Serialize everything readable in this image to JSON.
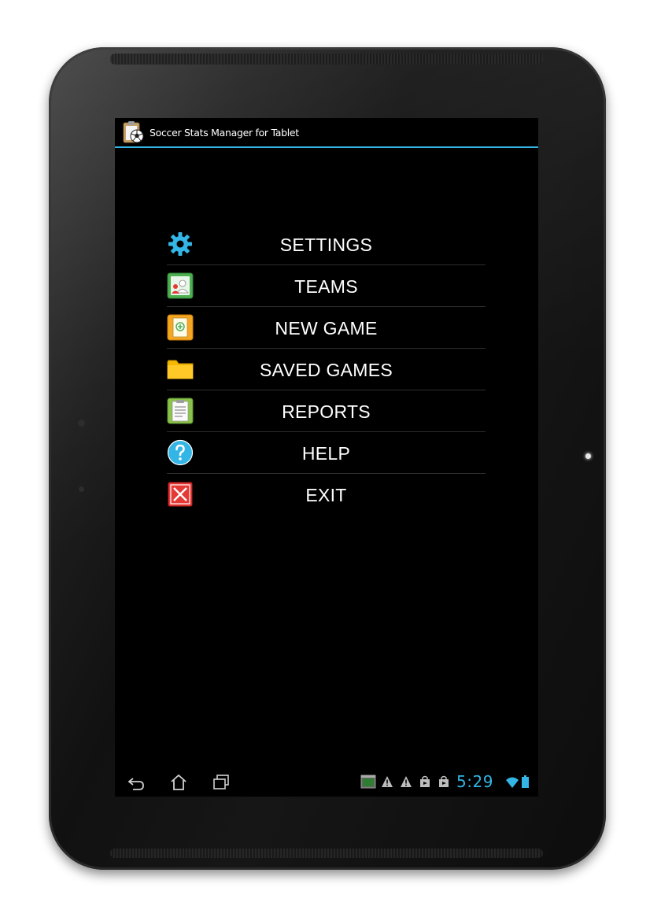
{
  "app": {
    "title": "Soccer Stats Manager for Tablet",
    "app_icon": "soccer-clipboard-icon"
  },
  "menu": {
    "items": [
      {
        "label": "SETTINGS",
        "icon": "gear-icon",
        "icon_color": "#33b5e5"
      },
      {
        "label": "TEAMS",
        "icon": "teams-icon",
        "icon_color": "#4caf50"
      },
      {
        "label": "NEW GAME",
        "icon": "new-game-icon",
        "icon_color": "#f5a623"
      },
      {
        "label": "SAVED GAMES",
        "icon": "folder-icon",
        "icon_color": "#f5b800"
      },
      {
        "label": "REPORTS",
        "icon": "reports-icon",
        "icon_color": "#8bc34a"
      },
      {
        "label": "HELP",
        "icon": "help-icon",
        "icon_color": "#33b5e5"
      },
      {
        "label": "EXIT",
        "icon": "exit-icon",
        "icon_color": "#e53935"
      }
    ]
  },
  "status_bar": {
    "time": "5:29",
    "accent_color": "#33b5e5",
    "nav_icons": [
      "back-icon",
      "home-icon",
      "recent-apps-icon"
    ],
    "notification_icons": [
      "screenshot-notification-icon",
      "warning-icon",
      "warning-icon",
      "store-bag-icon",
      "store-bag-icon"
    ],
    "system_icons": [
      "wifi-icon",
      "battery-icon"
    ]
  }
}
